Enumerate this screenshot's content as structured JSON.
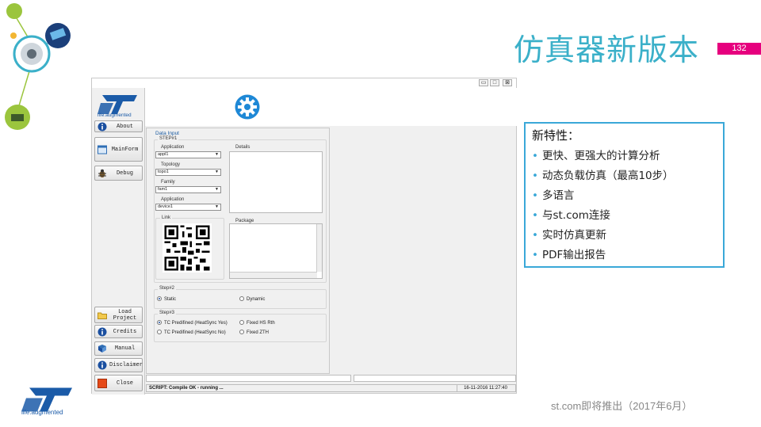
{
  "slide": {
    "title": "仿真器新版本",
    "page_number": "132",
    "logo_text": "life.augmented",
    "footer_note": "st.com即将推出（2017年6月）"
  },
  "features": {
    "title": "新特性：",
    "items": [
      "更快、更强大的计算分析",
      "动态负载仿真（最高10步）",
      "多语言",
      "与st.com连接",
      "实时仿真更新",
      "PDF输出报告"
    ]
  },
  "app": {
    "logo_text": "life.augmented",
    "window_controls": [
      "▭",
      "□",
      "⊠"
    ],
    "sidebar": {
      "about": "About",
      "mainform": "MainForm",
      "debug": "Debug",
      "load_project": "Load\nProject",
      "credits": "Credits",
      "manual": "Manual",
      "disclaimer": "Disclaimer",
      "close": "Close"
    },
    "data_input": {
      "title": "Data Input",
      "step1": "STEP#1",
      "application_label": "Application",
      "application_value": "appl1",
      "topology_label": "Topology",
      "topology_value": "topo1",
      "family_label": "Family",
      "family_value": "fam1",
      "application2_label": "Application",
      "application2_value": "device1",
      "details_label": "Details",
      "link_label": "Link",
      "package_label": "Package",
      "step2": "Step#2",
      "static": "Static",
      "dynamic": "Dynamic",
      "step3": "Step#3",
      "tc_yes": "TC Predifined (HeatSync Yes)",
      "tc_no": "TC Predifined (HeatSync No)",
      "fixed_hs": "Fixed HS Rth",
      "fixed_zth": "Fixed ZTH"
    },
    "status": {
      "text": "SCRIPT: Compile OK - running ...",
      "time": "16-11-2016 11:27:40"
    }
  },
  "colors": {
    "title": "#3bb0c9",
    "accent_pink": "#e6007e",
    "box_border": "#3aa8d8",
    "st_blue": "#1b5ba8"
  }
}
